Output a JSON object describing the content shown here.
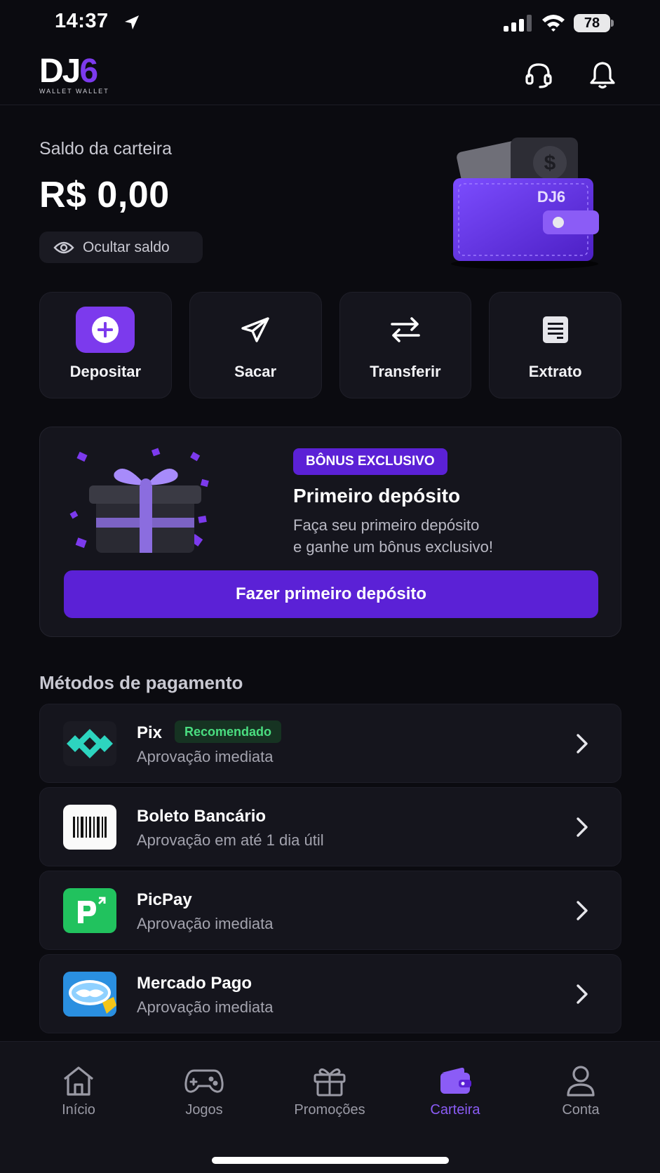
{
  "status_bar": {
    "time": "14:37",
    "battery": "78"
  },
  "header": {
    "logo_main": "DJ",
    "logo_accent": "6",
    "logo_sub": "WALLET WALLET"
  },
  "balance": {
    "label": "Saldo da carteira",
    "value": "R$ 0,00",
    "hide_label": "Ocultar saldo",
    "wallet_brand": "DJ6"
  },
  "actions": [
    {
      "label": "Depositar",
      "icon": "plus-icon"
    },
    {
      "label": "Sacar",
      "icon": "send-icon"
    },
    {
      "label": "Transferir",
      "icon": "transfer-icon"
    },
    {
      "label": "Extrato",
      "icon": "statement-icon"
    }
  ],
  "promo": {
    "badge": "BÔNUS EXCLUSIVO",
    "title": "Primeiro depósito",
    "desc_line1": "Faça seu primeiro depósito",
    "desc_line2": "e ganhe um bônus exclusivo!",
    "cta": "Fazer primeiro depósito"
  },
  "payments": {
    "title": "Métodos de pagamento",
    "items": [
      {
        "name": "Pix",
        "sub": "Aprovação imediata",
        "tag": "Recomendado",
        "icon": "pix-icon"
      },
      {
        "name": "Boleto Bancário",
        "sub": "Aprovação em até 1 dia útil",
        "icon": "barcode-icon"
      },
      {
        "name": "PicPay",
        "sub": "Aprovação imediata",
        "icon": "picpay-icon"
      },
      {
        "name": "Mercado Pago",
        "sub": "Aprovação imediata",
        "icon": "mercadopago-icon"
      }
    ]
  },
  "nav": [
    {
      "label": "Início",
      "icon": "home-icon",
      "active": false
    },
    {
      "label": "Jogos",
      "icon": "gamepad-icon",
      "active": false
    },
    {
      "label": "Promoções",
      "icon": "gift-icon",
      "active": false
    },
    {
      "label": "Carteira",
      "icon": "wallet-icon",
      "active": true
    },
    {
      "label": "Conta",
      "icon": "user-icon",
      "active": false
    }
  ],
  "colors": {
    "accent": "#7c3aed",
    "cta": "#5b21d6",
    "background": "#0b0b10",
    "card": "#15151d",
    "success": "#4ade80"
  }
}
